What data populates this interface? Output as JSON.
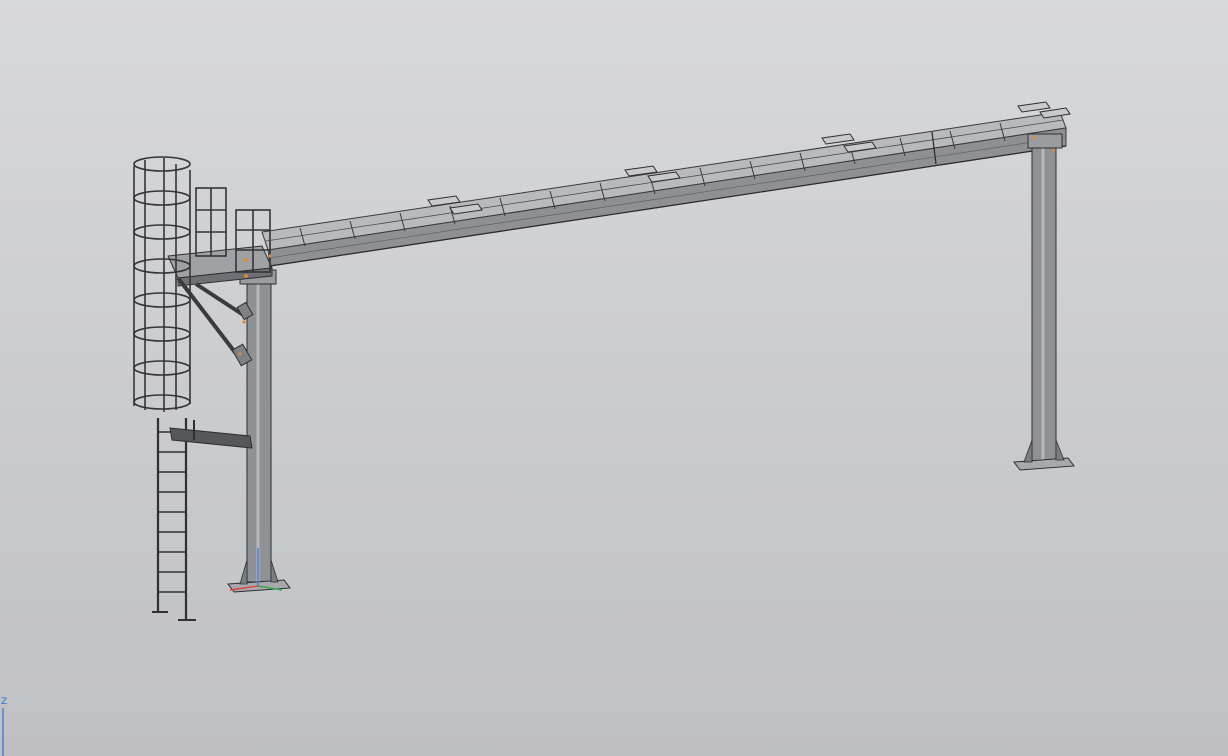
{
  "viewport": {
    "background_top": "#d8d9dc",
    "background_bottom": "#bfc0c3"
  },
  "model": {
    "steel_dark": "#3a3a3c",
    "steel_mid": "#7d7f83",
    "steel_light": "#b3b5b8",
    "anchor_color": "#d98a3a"
  },
  "origin_axes": {
    "x_color": "#e0453a",
    "y_color": "#3aa64a",
    "z_color": "#3a7fe0"
  },
  "corner_axis": {
    "label": "Z",
    "color": "#2f6fd6"
  }
}
